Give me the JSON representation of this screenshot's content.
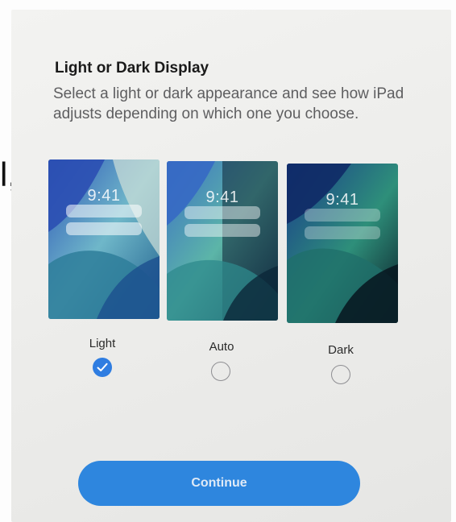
{
  "display_setup": {
    "title": "Light or Dark Display",
    "subtitle": "Select a light or dark appearance and see how iPad adjusts depending on which one you choose.",
    "options": [
      {
        "id": "light",
        "label": "Light",
        "time": "9:41",
        "selected": true
      },
      {
        "id": "auto",
        "label": "Auto",
        "time": "9:41",
        "selected": false
      },
      {
        "id": "dark",
        "label": "Dark",
        "time": "9:41",
        "selected": false
      }
    ],
    "continue_label": "Continue",
    "edge_text": "l,"
  },
  "colors": {
    "accent": "#2f7de1",
    "button": "#2e86de",
    "text_primary": "#1a1a1a",
    "text_secondary": "#5e5e60"
  },
  "icons": {
    "selected_radio": "checkmark-icon"
  }
}
